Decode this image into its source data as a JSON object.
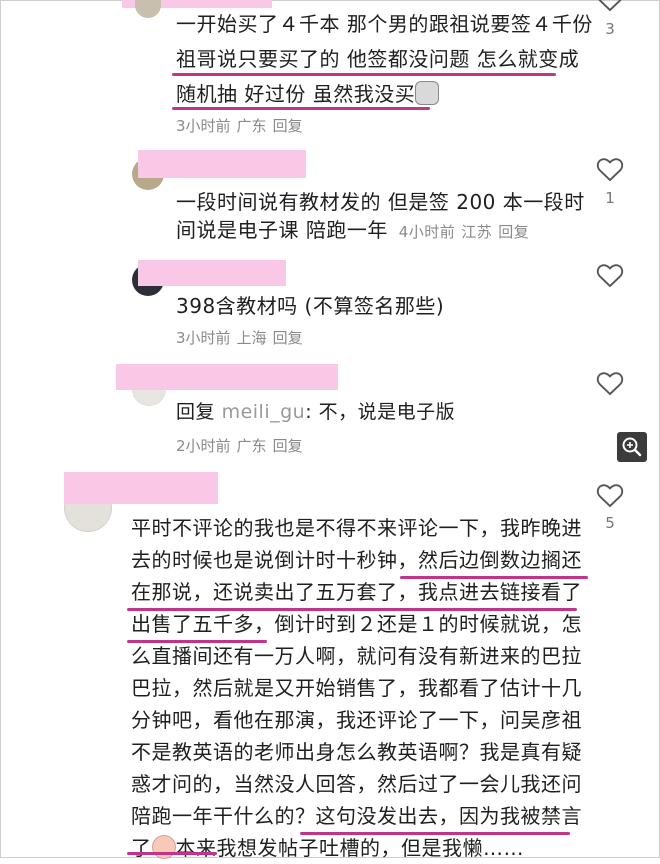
{
  "comments": [
    {
      "lines": [
        "一开始买了４千本 那个男的跟祖说要签４千份",
        "祖哥说只要买了的 他签都没问题 怎么就变成",
        "随机抽 好过份 虽然我没买"
      ],
      "time": "3小时前",
      "location": "广东",
      "reply_label": "回复",
      "like_count": "3"
    },
    {
      "lines": [
        "一段时间说有教材发的 但是签 200 本一段时",
        "间说是电子课 陪跑一年"
      ],
      "time": "4小时前",
      "location": "江苏",
      "reply_label": "回复",
      "like_count": "1"
    },
    {
      "lines": [
        "398含教材吗 (不算签名那些)"
      ],
      "time": "3小时前",
      "location": "上海",
      "reply_label": "回复",
      "like_count": ""
    },
    {
      "reply_prefix": "回复",
      "reply_to": "meili_gu",
      "reply_text": ": 不，说是电子版",
      "time": "2小时前",
      "location": "广东",
      "reply_label": "回复",
      "like_count": ""
    },
    {
      "lines": [
        "平时不评论的我也是不得不来评论一下，我昨晚进",
        "去的时候也是说倒计时十秒钟，然后边倒数边搁还",
        "在那说，还说卖出了五万套了，我点进去链接看了",
        "出售了五千多，倒计时到２还是１的时候就说，怎",
        "么直播间还有一万人啊，就问有没有新进来的巴拉",
        "巴拉，然后就是又开始销售了，我都看了估计十几",
        "分钟吧，看他在那演，我还评论了一下，问吴彦祖",
        "不是教英语的老师出身怎么教英语啊？我是真有疑",
        "惑才问的，当然没人回答，然后过了一会儿我还问",
        "陪跑一年干什么的？这句没发出去，因为我被禁言"
      ],
      "last_line_a": "了",
      "last_line_b": "本来我想发帖子吐槽的，但是我懒……",
      "like_count": "5"
    }
  ],
  "icons": {
    "heart": "heart-outline-icon",
    "zoom": "zoom-in-icon",
    "cat_emoji": "cat-face-emoji-icon",
    "cry_emoji": "crying-face-emoji-icon"
  },
  "colors": {
    "mask": "#f9c8e6",
    "underline": "#c2338a",
    "meta_text": "#8a8a8a"
  }
}
